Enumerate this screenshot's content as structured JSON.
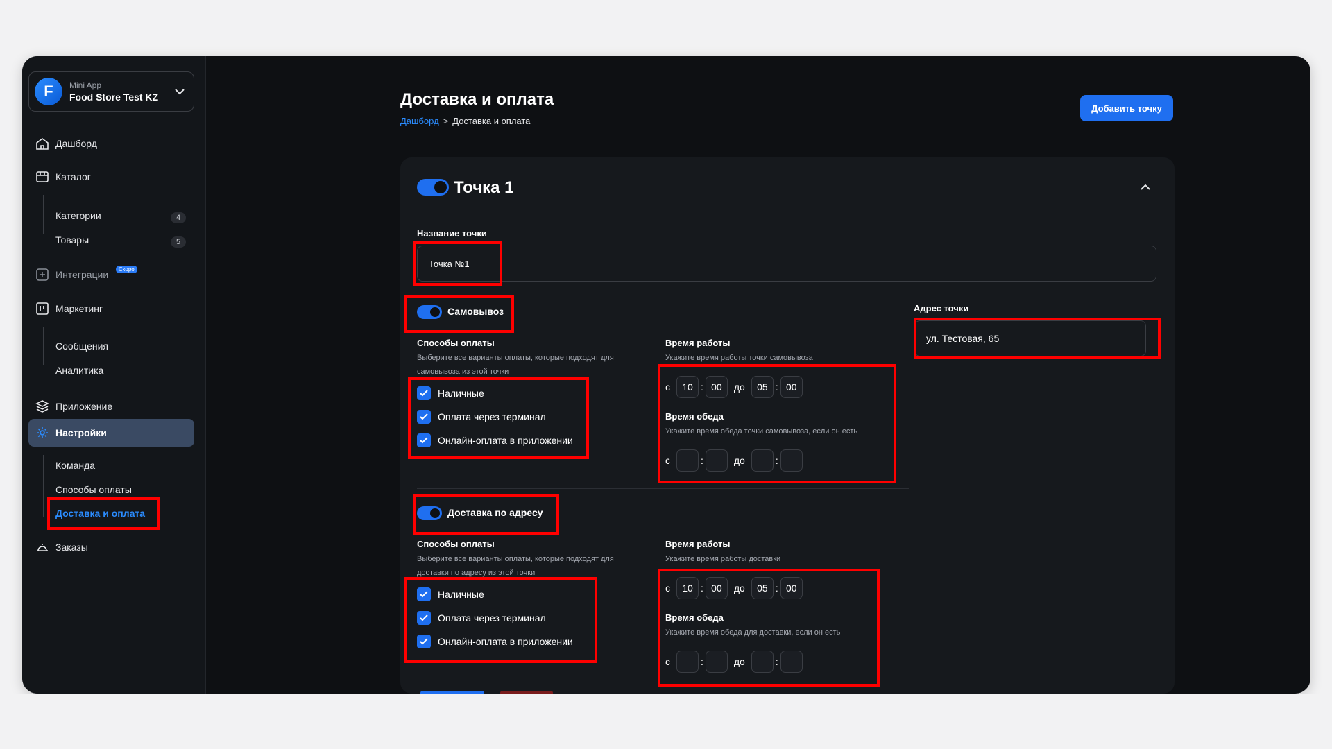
{
  "app": {
    "switch_small": "Mini App",
    "switch_name": "Food Store Test KZ",
    "logo_letter": "F"
  },
  "sidebar": {
    "dashboard": "Дашборд",
    "catalog": "Каталог",
    "categories": "Категории",
    "categories_count": "4",
    "products": "Товары",
    "products_count": "5",
    "integrations": "Интеграции",
    "soon": "Скоро",
    "marketing": "Маркетинг",
    "messages": "Сообщения",
    "analytics": "Аналитика",
    "application": "Приложение",
    "settings": "Настройки",
    "team": "Команда",
    "payment_methods": "Способы оплаты",
    "delivery_payment": "Доставка и оплата",
    "orders": "Заказы"
  },
  "header": {
    "title": "Доставка и оплата",
    "breadcrumb_root": "Дашборд",
    "breadcrumb_sep": ">",
    "breadcrumb_current": "Доставка и оплата",
    "add_button": "Добавить точку"
  },
  "point": {
    "title": "Точка 1",
    "name_label": "Название точки",
    "name_value": "Точка №1",
    "address_label": "Адрес точки",
    "address_value": "ул. Тестовая, 65"
  },
  "pickup": {
    "toggle_label": "Самовывоз",
    "payment_label": "Способы оплаты",
    "payment_desc_1": "Выберите все варианты оплаты, которые подходят для",
    "payment_desc_2": "самовывоза из этой точки",
    "options": [
      "Наличные",
      "Оплата через терминал",
      "Онлайн-оплата в приложении"
    ],
    "work_label": "Время работы",
    "work_desc": "Укажите время работы точки самовывоза",
    "lunch_label": "Время обеда",
    "lunch_desc": "Укажите время обеда точки самовывоза, если он есть"
  },
  "delivery": {
    "toggle_label": "Доставка по адресу",
    "payment_label": "Способы оплаты",
    "payment_desc_1": "Выберите все варианты оплаты, которые подходят для",
    "payment_desc_2": "доставки по адресу из этой точки",
    "options": [
      "Наличные",
      "Оплата через терминал",
      "Онлайн-оплата в приложении"
    ],
    "work_label": "Время работы",
    "work_desc": "Укажите время работы доставки",
    "lunch_label": "Время обеда",
    "lunch_desc": "Укажите время обеда для доставки, если он есть"
  },
  "time": {
    "from": "с",
    "to": "до",
    "colon": ":",
    "work_from_h": "10",
    "work_from_m": "00",
    "work_to_h": "05",
    "work_to_m": "00"
  },
  "colors": {
    "accent": "#1f6ff0",
    "highlight": "#ff0000",
    "background": "#0e1013"
  }
}
